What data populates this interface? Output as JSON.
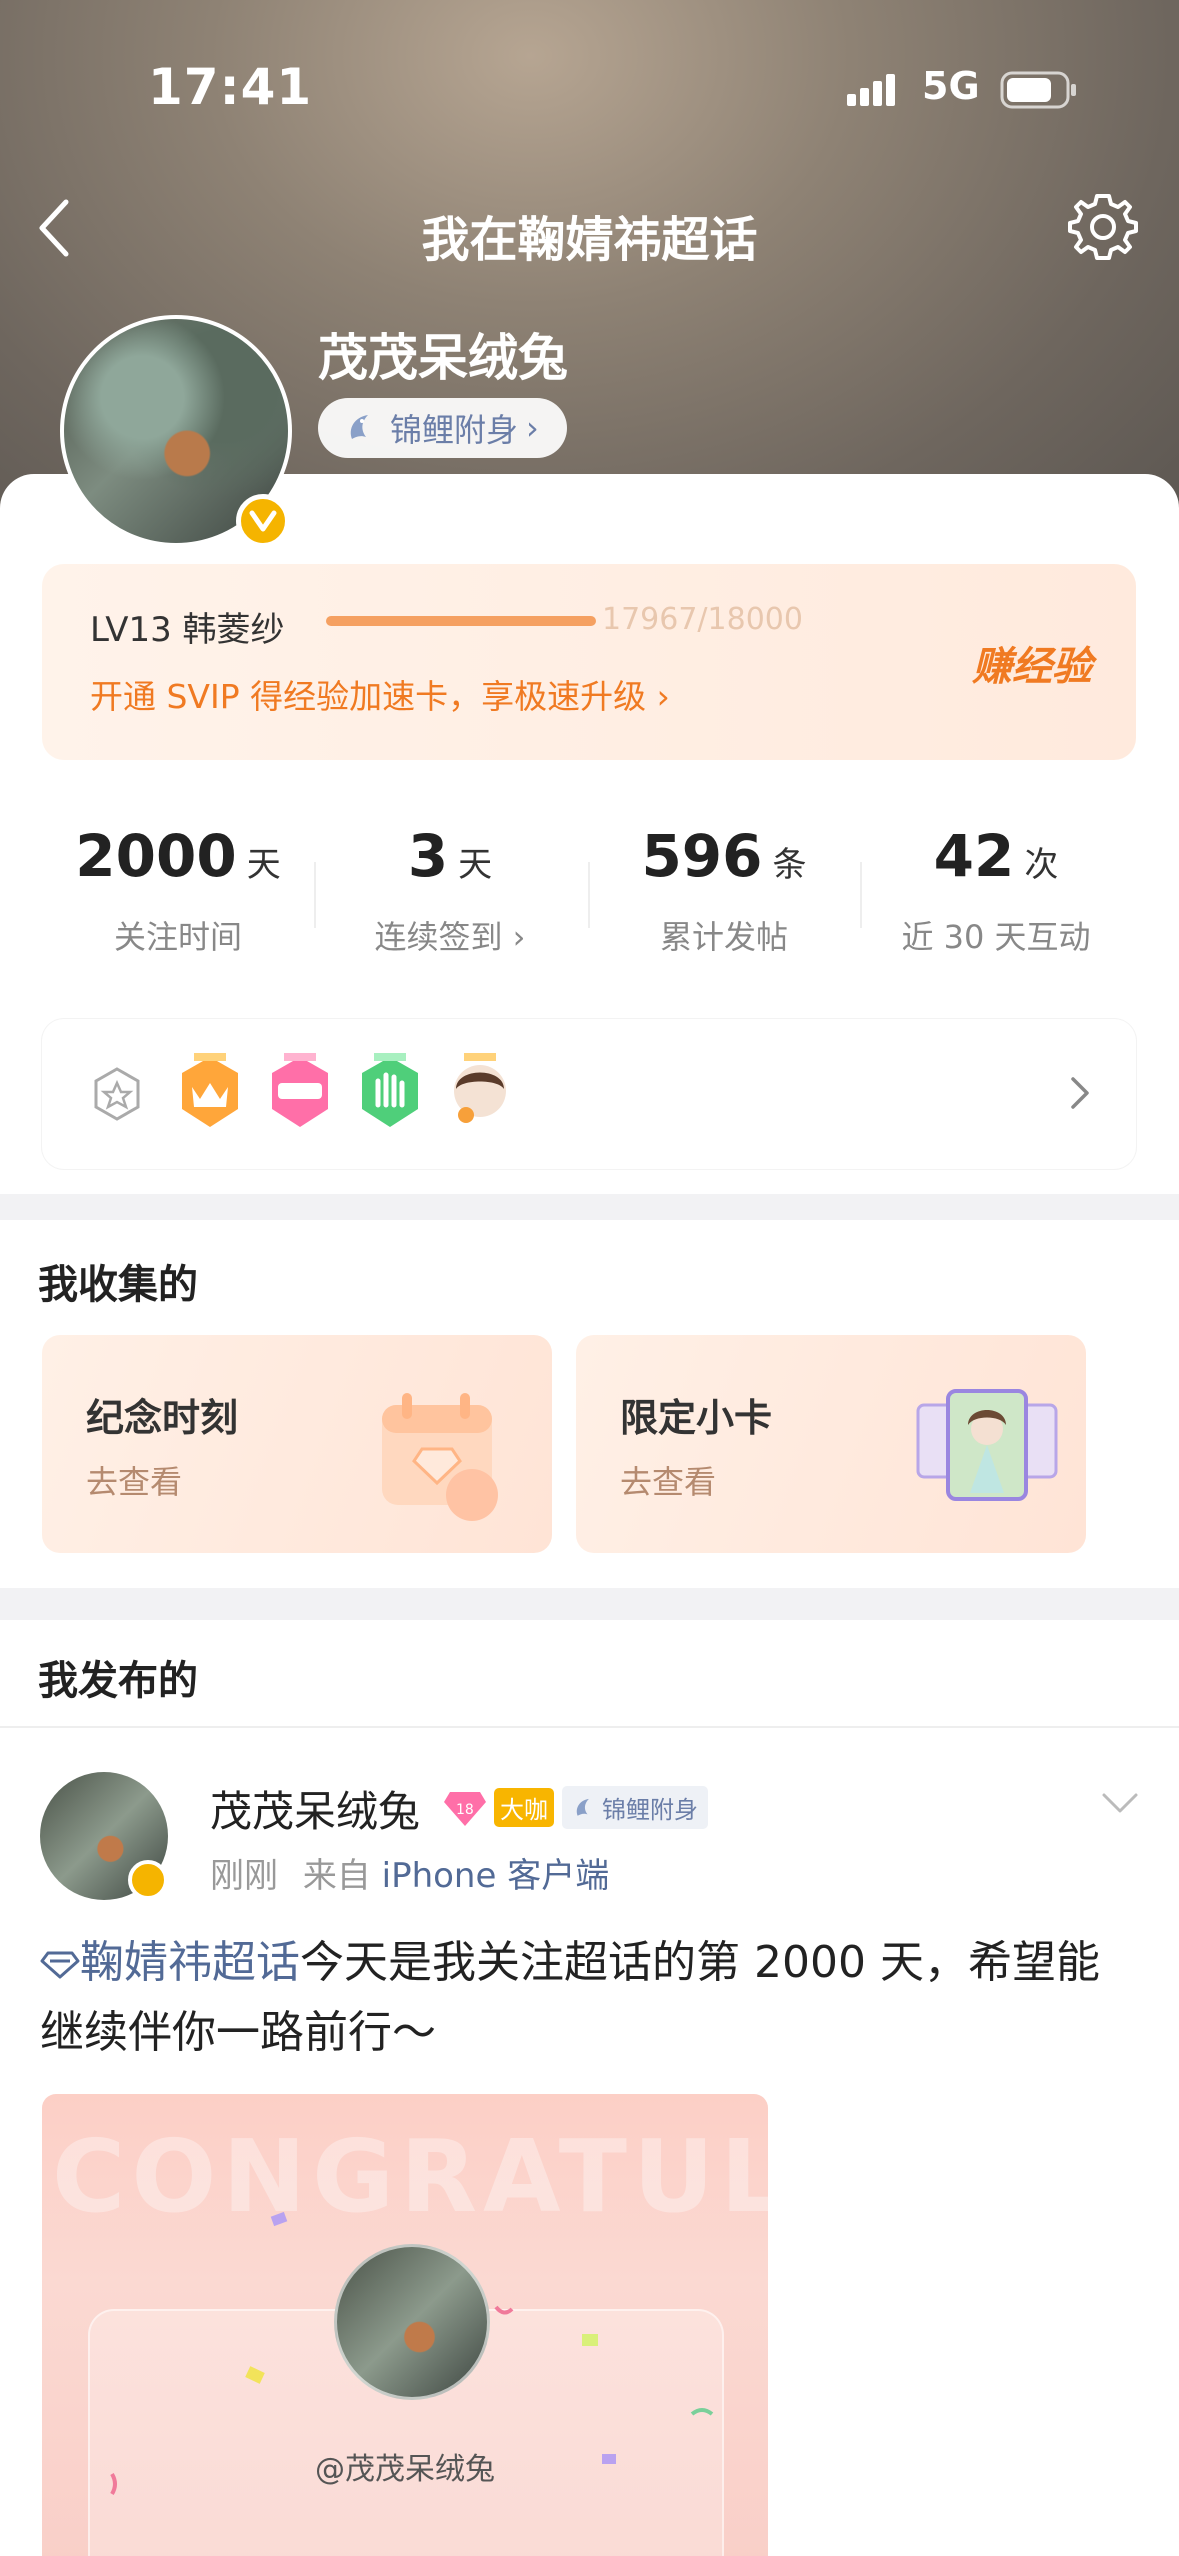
{
  "status_bar": {
    "time": "17:41",
    "network": "5G"
  },
  "nav": {
    "title": "我在鞠婧祎超话"
  },
  "profile": {
    "username": "茂茂呆绒兔",
    "koi_badge": "锦鲤附身",
    "koi_chevron": "›"
  },
  "level": {
    "label": "LV13 韩菱纱",
    "progress_text": "17967/18000",
    "progress_fraction": 0.998,
    "svip_text": "开通 SVIP 得经验加速卡，享极速升级 ›",
    "earn_button": "赚经验"
  },
  "stats": [
    {
      "value": "2000",
      "unit": "天",
      "label": "关注时间"
    },
    {
      "value": "3",
      "unit": "天",
      "label": "连续签到 ›"
    },
    {
      "value": "596",
      "unit": "条",
      "label": "累计发帖"
    },
    {
      "value": "42",
      "unit": "次",
      "label": "近 30 天互动"
    }
  ],
  "collections": {
    "title": "我收集的",
    "cards": [
      {
        "title": "纪念时刻",
        "action": "去查看"
      },
      {
        "title": "限定小卡",
        "action": "去查看"
      }
    ]
  },
  "posts": {
    "title": "我发布的",
    "item": {
      "author": "茂茂呆绒兔",
      "level_tag": "18",
      "tag_dk": "大咖",
      "tag_koi": "锦鲤附身",
      "time": "刚刚",
      "from_prefix": "来自",
      "device": "iPhone 客户端",
      "topic": "鞠婧祎超话",
      "text": "今天是我关注超话的第 2000 天，希望能继续伴你一路前行～",
      "image_banner": "CONGRATULATE",
      "image_handle": "@茂茂呆绒兔"
    }
  },
  "colors": {
    "accent_orange": "#f07a22",
    "link_blue": "#526a96",
    "verified_gold": "#f5b400"
  }
}
